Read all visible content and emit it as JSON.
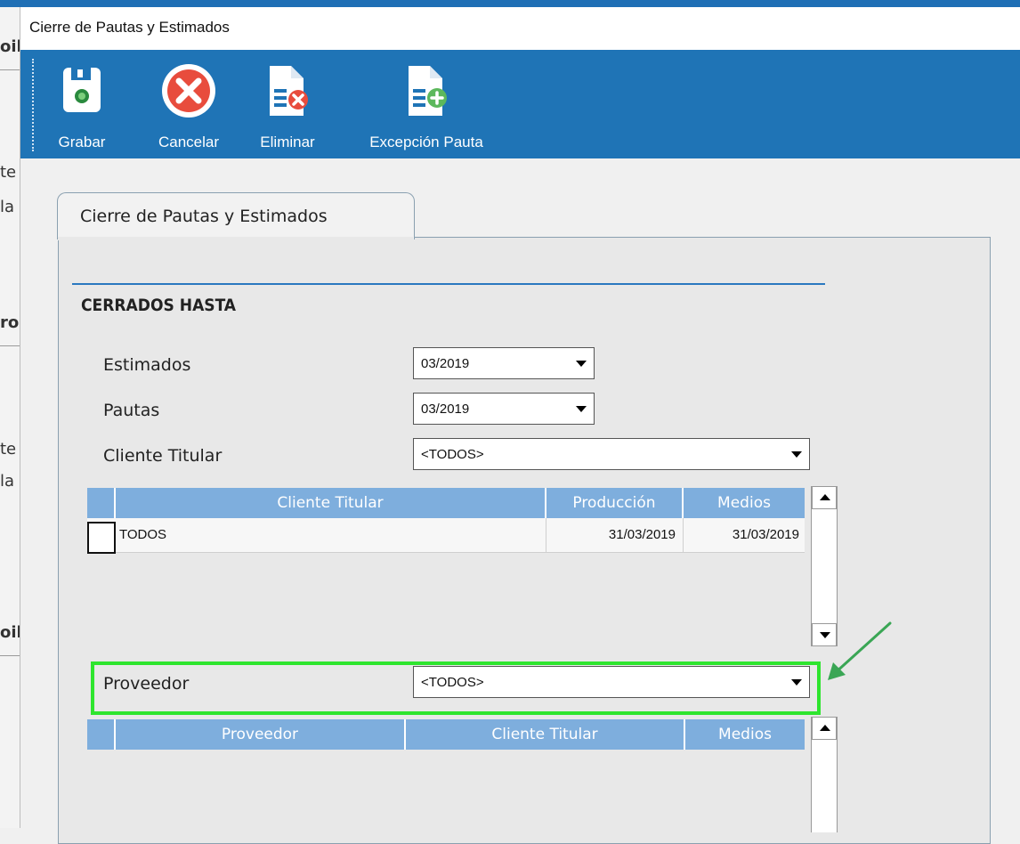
{
  "background_app": {
    "fragments": [
      "oil",
      "te",
      "la",
      "ros",
      "te",
      "la",
      "oil"
    ]
  },
  "window": {
    "title": "Cierre de Pautas y Estimados"
  },
  "toolbar": {
    "buttons": [
      {
        "label": "Grabar",
        "icon": "save-icon"
      },
      {
        "label": "Cancelar",
        "icon": "cancel-icon"
      },
      {
        "label": "Eliminar",
        "icon": "delete-doc-icon"
      },
      {
        "label": "Excepción Pauta",
        "icon": "add-doc-icon"
      }
    ]
  },
  "tab": {
    "label": "Cierre de Pautas y Estimados"
  },
  "section": {
    "title": "CERRADOS HASTA"
  },
  "fields": {
    "estimados": {
      "label": "Estimados",
      "value": "03/2019"
    },
    "pautas": {
      "label": "Pautas",
      "value": "03/2019"
    },
    "cliente_titular": {
      "label": "Cliente Titular",
      "value": "<TODOS>"
    },
    "proveedor": {
      "label": "Proveedor",
      "value": "<TODOS>"
    }
  },
  "grid_clientes": {
    "columns": [
      "Cliente Titular",
      "Producción",
      "Medios"
    ],
    "rows": [
      {
        "cliente": "TODOS",
        "produccion": "31/03/2019",
        "medios": "31/03/2019"
      }
    ]
  },
  "grid_proveedores": {
    "columns": [
      "Proveedor",
      "Cliente Titular",
      "Medios"
    ],
    "rows": []
  },
  "colors": {
    "toolbar": "#1f74b6",
    "grid_header": "#7eaedd",
    "highlight": "#2ee52e",
    "annotation_arrow": "#3aa655"
  }
}
